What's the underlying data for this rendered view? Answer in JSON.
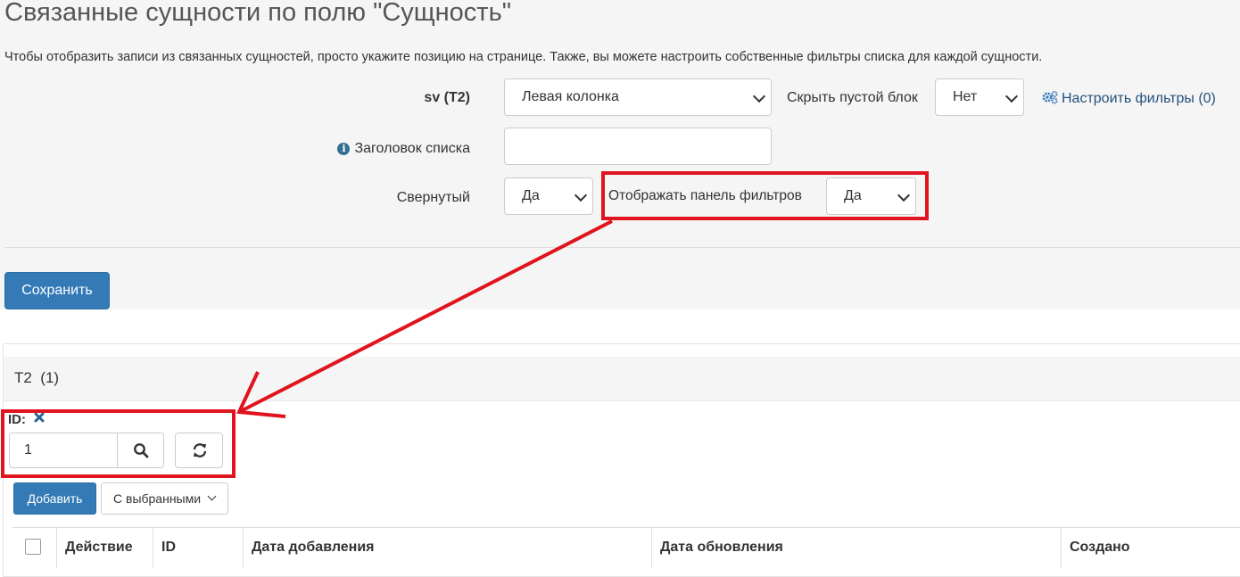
{
  "page": {
    "title": "Связанные сущности по полю \"Сущность\"",
    "description": "Чтобы отобразить записи из связанных сущностей, просто укажите позицию на странице. Также, вы можете настроить собственные фильтры списка для каждой сущности."
  },
  "form": {
    "entity_label": "sv (T2)",
    "position_value": "Левая колонка",
    "hide_empty_label": "Скрыть пустой блок",
    "hide_empty_value": "Нет",
    "filters_link": "Настроить фильтры (0)",
    "list_title_label": "Заголовок списка",
    "list_title_value": "",
    "collapsed_label": "Свернутый",
    "collapsed_value": "Да",
    "show_filter_panel_label": "Отображать панель фильтров",
    "show_filter_panel_value": "Да",
    "save_label": "Сохранить"
  },
  "panel": {
    "title": "T2",
    "count": "(1)",
    "filter_label": "ID:",
    "filter_value": "1",
    "add_label": "Добавить",
    "with_selected_label": "С выбранными"
  },
  "table": {
    "columns": [
      "Действие",
      "ID",
      "Дата добавления",
      "Дата обновления",
      "Создано"
    ]
  },
  "icons": {
    "info": "info-icon",
    "gears": "gears-icon",
    "remove": "remove-icon",
    "search": "search-icon",
    "refresh": "refresh-icon",
    "chevron": "chevron-down-icon"
  },
  "colors": {
    "primary": "#337ab7",
    "link": "#23527c",
    "annotation": "#e0141e",
    "background": "#f5f5f5"
  }
}
